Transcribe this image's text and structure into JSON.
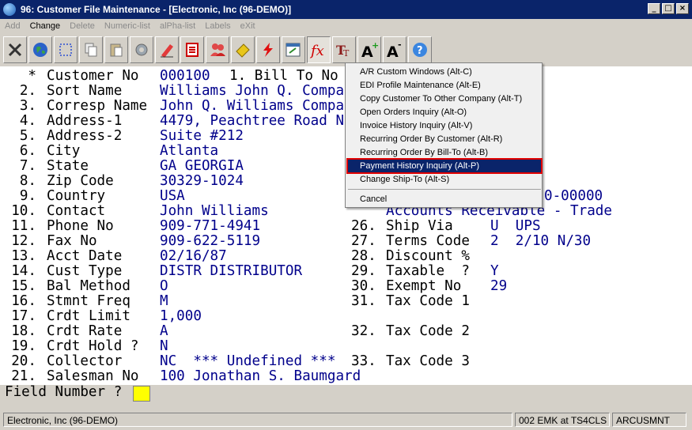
{
  "window": {
    "title": "96: Customer File Maintenance - [Electronic, Inc (96-DEMO)]"
  },
  "menu": [
    "Add",
    "Change",
    "Delete",
    "Numeric-list",
    "alPha-list",
    "Labels",
    "eXit"
  ],
  "menu_enabled": "Change",
  "toolbar_icons": [
    "exit-icon",
    "globe-icon",
    "select-icon",
    "copy-icon",
    "paste-icon",
    "settings-icon",
    "edit-icon",
    "list-icon",
    "users-icon",
    "tag-icon",
    "lightning-icon",
    "calendar-icon",
    "function-icon",
    "font-icon",
    "font-increase-icon",
    "font-decrease-icon",
    "help-icon"
  ],
  "fields_left": [
    {
      "num": "*",
      "label": "Customer No",
      "value": "000100"
    },
    {
      "num": "2.",
      "label": "Sort Name",
      "value": "Williams John Q. Compa"
    },
    {
      "num": "3.",
      "label": "Corresp Name",
      "value": "John Q. Williams Compa"
    },
    {
      "num": "4.",
      "label": "Address-1",
      "value": "4479, Peachtree Road N"
    },
    {
      "num": "5.",
      "label": "Address-2",
      "value": "Suite #212"
    },
    {
      "num": "6.",
      "label": "City",
      "value": "Atlanta"
    },
    {
      "num": "7.",
      "label": "State",
      "value": "GA GEORGIA"
    },
    {
      "num": "8.",
      "label": "Zip Code",
      "value": "30329-1024"
    },
    {
      "num": "9.",
      "label": "Country",
      "value": "USA"
    },
    {
      "num": "10.",
      "label": "Contact",
      "value": "John Williams"
    },
    {
      "num": "11.",
      "label": "Phone No",
      "value": "909-771-4941"
    },
    {
      "num": "12.",
      "label": "Fax No",
      "value": "909-622-5119"
    },
    {
      "num": "13.",
      "label": "Acct Date",
      "value": "02/16/87"
    },
    {
      "num": "14.",
      "label": "Cust Type",
      "value": "DISTR DISTRIBUTOR"
    },
    {
      "num": "15.",
      "label": "Bal Method",
      "value": "O"
    },
    {
      "num": "16.",
      "label": "Stmnt Freq",
      "value": "M"
    },
    {
      "num": "17.",
      "label": "Crdt Limit",
      "value": "1,000"
    },
    {
      "num": "18.",
      "label": "Crdt Rate",
      "value": "A"
    },
    {
      "num": "19.",
      "label": "Crdt Hold ?",
      "value": "N"
    },
    {
      "num": "20.",
      "label": "Collector",
      "value": "NC  *** Undefined ***"
    },
    {
      "num": "21.",
      "label": "Salesman No",
      "value": "100 Jonathan S. Baumgard"
    }
  ],
  "bill_to_label": "1. Bill To No",
  "right_fragments": {
    "account_no_tail": "0-00000",
    "account_desc": "Accounts Receivable - Trade"
  },
  "fields_right": [
    {
      "num": "26.",
      "label": "Ship Via",
      "value": "U  UPS"
    },
    {
      "num": "27.",
      "label": "Terms Code",
      "value": "2  2/10 N/30"
    },
    {
      "num": "28.",
      "label": "Discount %",
      "value": ""
    },
    {
      "num": "29.",
      "label": "Taxable  ?",
      "value": "Y"
    },
    {
      "num": "30.",
      "label": "Exempt No",
      "value": "29"
    },
    {
      "num": "31.",
      "label": "Tax Code 1",
      "value": ""
    },
    {
      "num": "32.",
      "label": "Tax Code 2",
      "value": ""
    },
    {
      "num": "33.",
      "label": "Tax Code 3",
      "value": ""
    }
  ],
  "prompt": {
    "label": "Field Number ?",
    "value": ""
  },
  "dropdown": {
    "items": [
      "A/R Custom Windows  (Alt-C)",
      "EDI Profile Maintenance  (Alt-E)",
      "Copy Customer To Other Company  (Alt-T)",
      "Open Orders Inquiry  (Alt-O)",
      "Invoice History Inquiry  (Alt-V)",
      "Recurring Order By Customer  (Alt-R)",
      "Recurring Order By Bill-To  (Alt-B)",
      "Payment History Inquiry  (Alt-P)",
      "Change Ship-To  (Alt-S)"
    ],
    "selected": "Payment History Inquiry  (Alt-P)",
    "cancel": "Cancel"
  },
  "status": {
    "company": "Electronic, Inc (96-DEMO)",
    "session": "002 EMK at TS4CLS",
    "program": "ARCUSMNT"
  },
  "colors": {
    "title_bg": "#0a246a",
    "value_text": "#00008b",
    "highlight_border": "#e00000",
    "cursor_bg": "#ffff00"
  }
}
